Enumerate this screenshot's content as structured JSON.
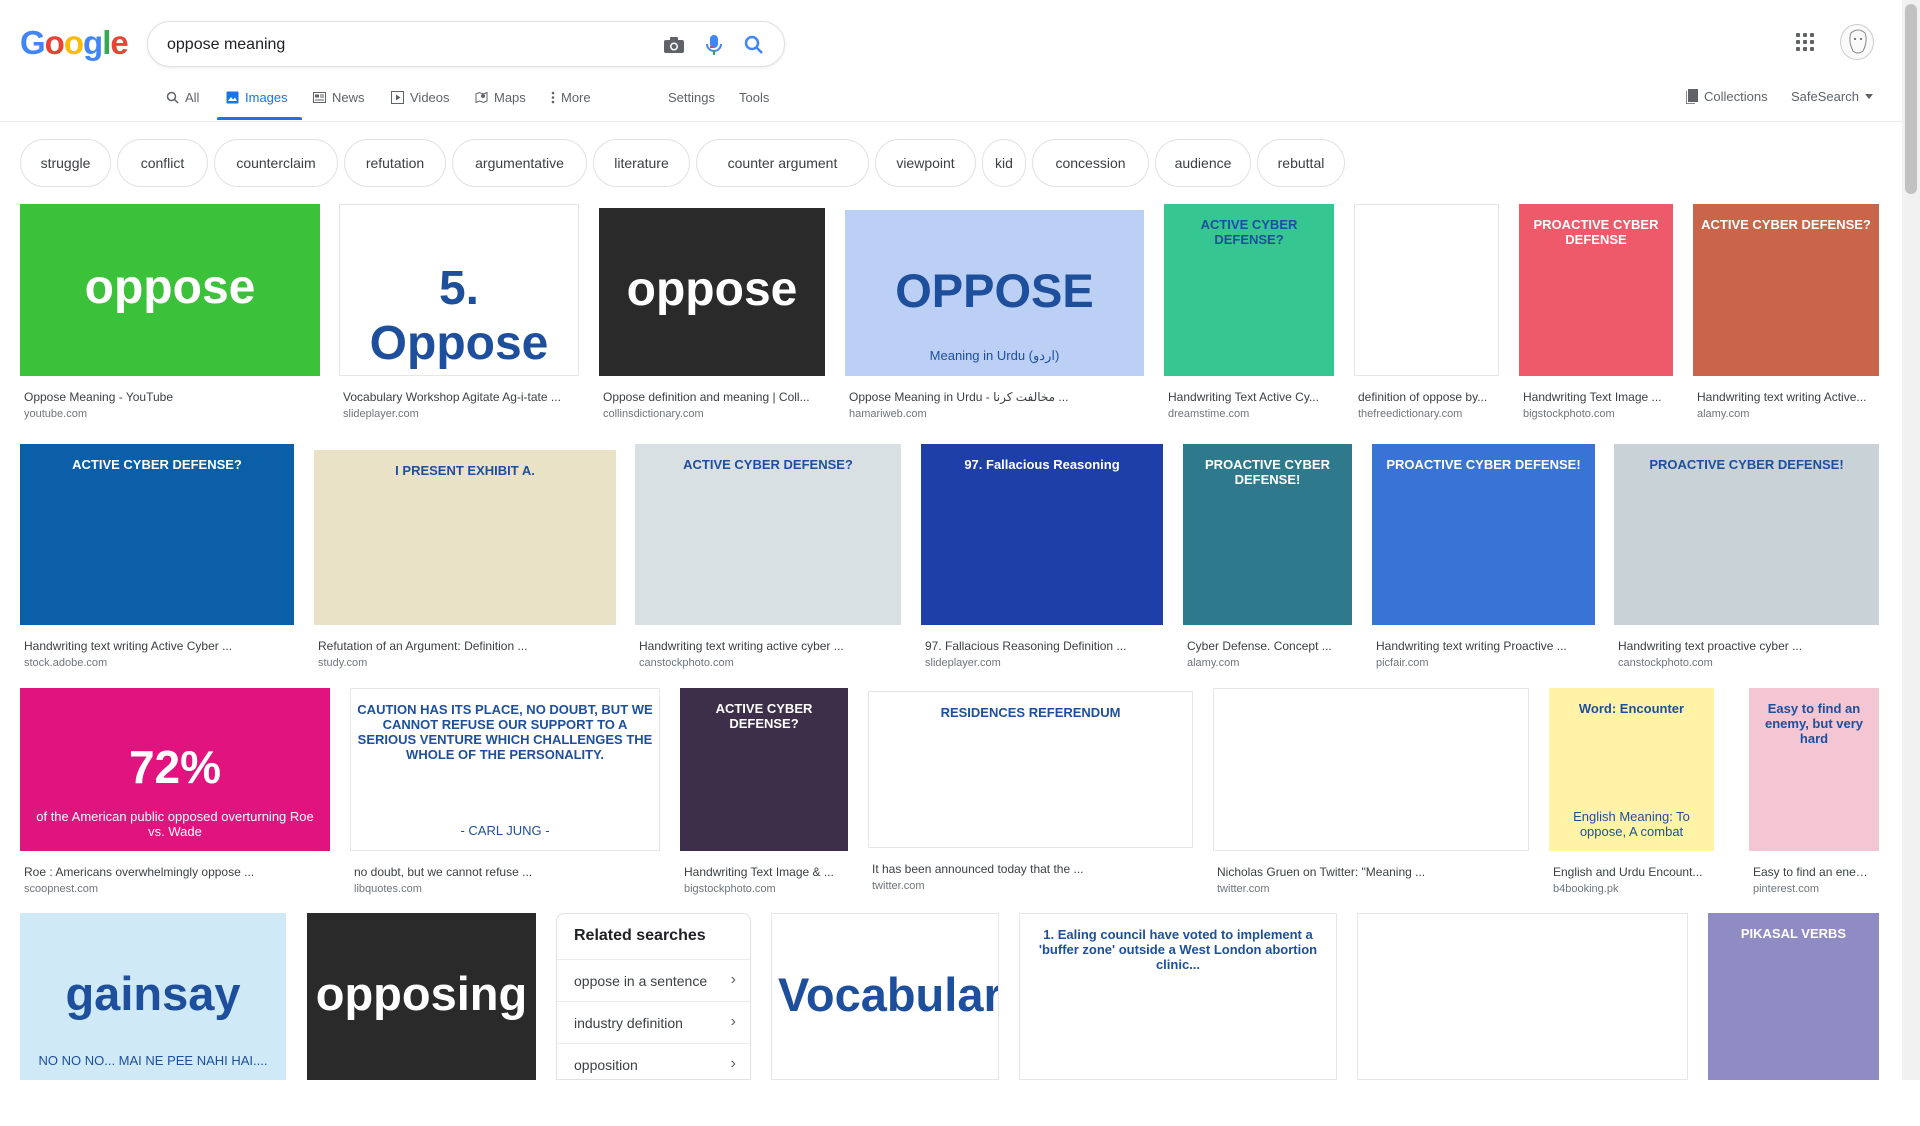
{
  "search": {
    "query": "oppose meaning"
  },
  "logo": {
    "letters": [
      "G",
      "o",
      "o",
      "g",
      "l",
      "e"
    ],
    "colors": [
      "#4285f4",
      "#ea4335",
      "#fbbc05",
      "#4285f4",
      "#34a853",
      "#ea4335"
    ]
  },
  "nav": {
    "tabs": [
      {
        "label": "All",
        "icon": "search-icon"
      },
      {
        "label": "Images",
        "icon": "image-icon"
      },
      {
        "label": "News",
        "icon": "newspaper-icon"
      },
      {
        "label": "Videos",
        "icon": "play-icon"
      },
      {
        "label": "Maps",
        "icon": "map-pin-icon"
      },
      {
        "label": "More",
        "icon": "more-vert-icon"
      }
    ],
    "settings": "Settings",
    "tools": "Tools",
    "collections": "Collections",
    "safesearch": "SafeSearch"
  },
  "chips": [
    "struggle",
    "conflict",
    "counterclaim",
    "refutation",
    "argumentative",
    "literature",
    "counter argument",
    "viewpoint",
    "kid",
    "concession",
    "audience",
    "rebuttal"
  ],
  "results": [
    {
      "title": "Oppose Meaning - YouTube",
      "site": "youtube.com",
      "img_text": "oppose",
      "bg": "#3cc13b"
    },
    {
      "title": "Vocabulary Workshop Agitate Ag-i-tate ...",
      "site": "slideplayer.com",
      "img_text": "5. Oppose",
      "bg": "#ffffff"
    },
    {
      "title": "Oppose definition and meaning | Coll...",
      "site": "collinsdictionary.com",
      "img_text": "oppose",
      "bg": "#2a2a2a"
    },
    {
      "title": "Oppose Meaning in Urdu - مخالفت کرنا ...",
      "site": "hamariweb.com",
      "img_text": "OPPOSE",
      "img_sub": "Meaning in Urdu (اردو)",
      "bg": "#bcd0f5"
    },
    {
      "title": "Handwriting Text Active Cy...",
      "site": "dreamstime.com",
      "img_text": "ACTIVE CYBER DEFENSE?",
      "bg": "#36c691"
    },
    {
      "title": "definition of oppose by...",
      "site": "thefreedictionary.com",
      "img_text": "",
      "bg": "#ffffff"
    },
    {
      "title": "Handwriting Text Image ...",
      "site": "bigstockphoto.com",
      "img_text": "PROACTIVE CYBER DEFENSE",
      "bg": "#ef5a6a"
    },
    {
      "title": "Handwriting text writing Active...",
      "site": "alamy.com",
      "img_text": "ACTIVE CYBER DEFENSE?",
      "bg": "#c8654a"
    },
    {
      "title": "Handwriting text writing Active Cyber ...",
      "site": "stock.adobe.com",
      "img_text": "ACTIVE CYBER DEFENSE?",
      "bg": "#0b5ea8"
    },
    {
      "title": "Refutation of an Argument: Definition ...",
      "site": "study.com",
      "img_text": "I PRESENT EXHIBIT A.",
      "bg": "#e9e2c7"
    },
    {
      "title": "Handwriting text writing active cyber ...",
      "site": "canstockphoto.com",
      "img_text": "ACTIVE CYBER DEFENSE?",
      "bg": "#d9e0e4"
    },
    {
      "title": "97. Fallacious Reasoning Definition ...",
      "site": "slideplayer.com",
      "img_text": "97. Fallacious Reasoning",
      "bg": "#1f3fa8"
    },
    {
      "title": "Cyber Defense. Concept ...",
      "site": "alamy.com",
      "img_text": "PROACTIVE CYBER DEFENSE!",
      "bg": "#2e7a8c"
    },
    {
      "title": "Handwriting text writing Proactive ...",
      "site": "picfair.com",
      "img_text": "PROACTIVE CYBER DEFENSE!",
      "bg": "#3a73d6"
    },
    {
      "title": "Handwriting text proactive cyber ...",
      "site": "canstockphoto.com",
      "img_text": "PROACTIVE CYBER DEFENSE!",
      "bg": "#c9d2d6"
    },
    {
      "title": "Roe : Americans overwhelmingly oppose ...",
      "site": "scoopnest.com",
      "img_text": "72%",
      "img_sub": "of the American public opposed overturning Roe vs. Wade",
      "bg": "#e0137f"
    },
    {
      "title": "no doubt, but we cannot refuse ...",
      "site": "libquotes.com",
      "img_text": "CAUTION HAS ITS PLACE, NO DOUBT, BUT WE CANNOT REFUSE OUR SUPPORT TO A SERIOUS VENTURE WHICH CHALLENGES THE WHOLE OF THE PERSONALITY.",
      "img_sub": "- CARL JUNG -",
      "bg": "#ffffff"
    },
    {
      "title": "Handwriting Text Image & ...",
      "site": "bigstockphoto.com",
      "img_text": "ACTIVE CYBER DEFENSE?",
      "bg": "#3d2f4a"
    },
    {
      "title": "It has been announced today that the ...",
      "site": "twitter.com",
      "img_text": "RESIDENCES REFERENDUM",
      "bg": "#ffffff"
    },
    {
      "title": "Nicholas Gruen on Twitter: \"Meaning ...",
      "site": "twitter.com",
      "img_text": "",
      "bg": "#ffffff"
    },
    {
      "title": "English and Urdu Encount...",
      "site": "b4booking.pk",
      "img_text": "Word: Encounter",
      "img_sub": "English Meaning: To oppose, A combat",
      "bg": "#fff3a8"
    },
    {
      "title": "Easy to find an enemy...",
      "site": "pinterest.com",
      "img_text": "Easy to find an enemy, but very hard",
      "bg": "#f4c6d4"
    },
    {
      "title": "",
      "site": "",
      "img_text": "gainsay",
      "img_sub": "NO NO NO... MAI NE PEE NAHI HAI....",
      "bg": "#cfe9f7"
    },
    {
      "title": "",
      "site": "",
      "img_text": "opposing",
      "bg": "#2a2a2a"
    },
    {
      "title": "",
      "site": "",
      "img_text": "Vocabulary",
      "bg": "#ffffff"
    },
    {
      "title": "",
      "site": "",
      "img_text": "1. Ealing council have voted to implement a 'buffer zone' outside a West London abortion clinic...",
      "bg": "#ffffff"
    },
    {
      "title": "",
      "site": "",
      "img_text": "",
      "bg": "#ffffff"
    },
    {
      "title": "",
      "site": "",
      "img_text": "PIKASAL VERBS",
      "bg": "#8e8cc2"
    }
  ],
  "related": {
    "title": "Related searches",
    "items": [
      "oppose in a sentence",
      "industry definition",
      "opposition"
    ]
  }
}
